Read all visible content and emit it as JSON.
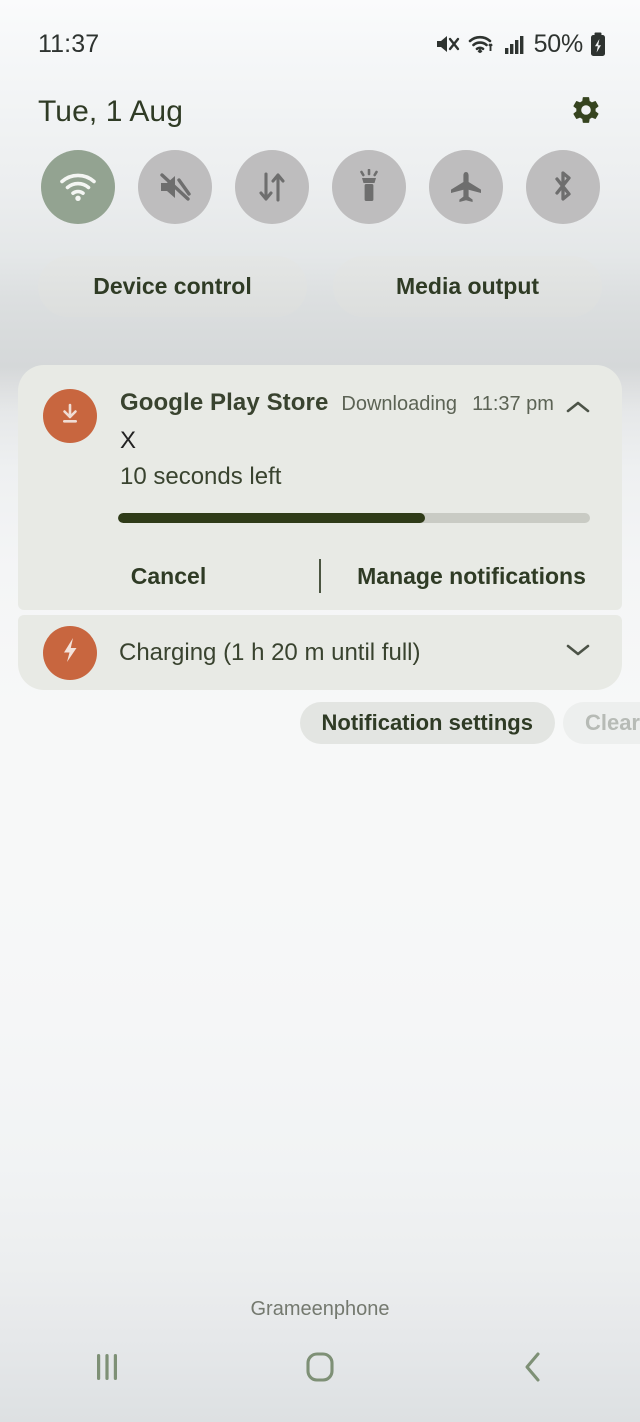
{
  "statusbar": {
    "time": "11:37",
    "battery_percent": "50%",
    "icons": [
      "mute-icon",
      "wifi-icon",
      "signal-icon",
      "battery-charging-icon"
    ]
  },
  "header": {
    "date": "Tue, 1 Aug",
    "settings_icon": "gear-icon"
  },
  "quick_settings": {
    "toggles": [
      {
        "name": "wifi",
        "icon": "wifi-icon",
        "active": true
      },
      {
        "name": "sound",
        "icon": "mute-icon",
        "active": false
      },
      {
        "name": "mobile-data",
        "icon": "data-arrows-icon",
        "active": false
      },
      {
        "name": "flashlight",
        "icon": "flashlight-icon",
        "active": false
      },
      {
        "name": "airplane",
        "icon": "airplane-icon",
        "active": false
      },
      {
        "name": "bluetooth",
        "icon": "bluetooth-icon",
        "active": false
      }
    ],
    "active_color": "#93a391",
    "inactive_color": "#bebdbe"
  },
  "shortcuts": {
    "device_control": "Device control",
    "media_output": "Media output"
  },
  "notifications": [
    {
      "id": "play-store-download",
      "app": "Google Play Store",
      "status": "Downloading",
      "time": "11:37 pm",
      "title": "X",
      "body": "10 seconds left",
      "icon": "download-icon",
      "icon_bg": "#c8663f",
      "expand_icon": "chevron-up-icon",
      "progress_percent": 65,
      "progress_fill_color": "#2f3b18",
      "progress_track_color": "#c9cbc4",
      "actions": [
        "Cancel",
        "Manage notifications"
      ]
    },
    {
      "id": "charging",
      "title": "Charging (1 h 20 m until full)",
      "icon": "lightning-bolt-icon",
      "icon_bg": "#c8663f",
      "expand_icon": "chevron-down-icon"
    }
  ],
  "footer_buttons": {
    "notification_settings": "Notification settings",
    "clear": "Clear"
  },
  "carrier": "Grameenphone",
  "navbar": {
    "recents": "recents-icon",
    "home": "home-icon",
    "back": "back-icon",
    "color": "#7e9076"
  }
}
